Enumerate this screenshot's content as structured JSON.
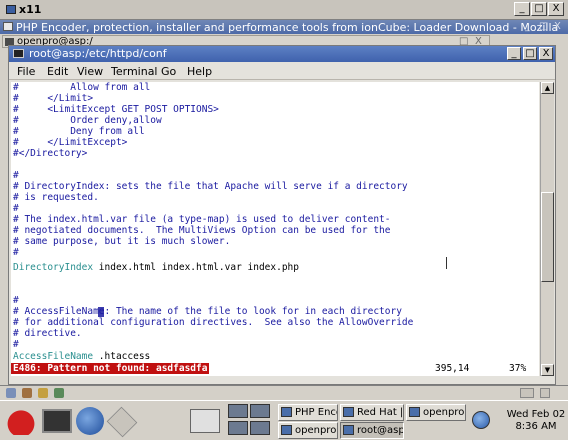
{
  "x11": {
    "title": "x11",
    "min": "_",
    "max": "□",
    "close": "X"
  },
  "mozilla": {
    "title": "PHP Encoder, protection, installer and performance tools from ionCube: Loader Download - Mozilla",
    "controls": [
      "_",
      "□",
      "X"
    ]
  },
  "openpro": {
    "title": "openpro@asp:/",
    "controls": [
      "_",
      "□",
      "X"
    ]
  },
  "terminal": {
    "title": "root@asp:/etc/httpd/conf",
    "controls": [
      "_",
      "□",
      "X"
    ],
    "menu": [
      "File",
      "Edit",
      "View",
      "Terminal",
      "Go",
      "Help"
    ],
    "lines": [
      "#         Allow from all",
      "#     </Limit>",
      "#     <LimitExcept GET POST OPTIONS>",
      "#         Order deny,allow",
      "#         Deny from all",
      "#     </LimitExcept>",
      "#</Directory>",
      "",
      "#",
      "# DirectoryIndex: sets the file that Apache will serve if a directory",
      "# is requested.",
      "#",
      "# The index.html.var file (a type-map) is used to deliver content-",
      "# negotiated documents.  The MultiViews Option can be used for the",
      "# same purpose, but it is much slower.",
      "#",
      "",
      "",
      "#",
      "# AccessFileName: The name of the file to look for in each directory",
      "# for additional configuration directives.  See also the AllowOverride",
      "# directive.",
      "#"
    ],
    "directive1_key": "DirectoryIndex",
    "directive1_val": " index.html index.html.var index.php",
    "directive2_key": "AccessFileName",
    "directive2_val": " .htaccess",
    "status_error": "E486: Pattern not found: asdfasdfa",
    "status_pos": "395,14",
    "status_pct": "37%"
  },
  "taskbar": {
    "buttons": [
      "PHP Encod",
      "Red Hat | Tl",
      "openpro@a:",
      "openpro@a",
      "root@asp:/e"
    ],
    "date": "Wed Feb 02",
    "time": "8:36 AM"
  }
}
